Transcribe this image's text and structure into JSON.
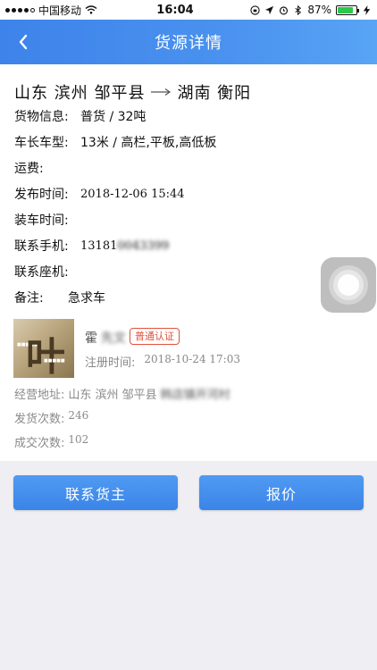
{
  "status_bar": {
    "carrier": "中国移动",
    "time": "16:04",
    "battery": "87%",
    "battery_fill": 0.87
  },
  "nav": {
    "title": "货源详情"
  },
  "route": {
    "from": "山东 滨州 邹平县",
    "to": "湖南 衡阳"
  },
  "details": {
    "cargo": {
      "label": "货物信息:",
      "value": "普货 / 32吨"
    },
    "truck": {
      "label": "车长车型:",
      "value": "13米 / 高栏,平板,高低板"
    },
    "fee": {
      "label": "运费:",
      "value": ""
    },
    "publish": {
      "label": "发布时间:",
      "value": "2018-12-06 15:44"
    },
    "load": {
      "label": "装车时间:",
      "value": ""
    },
    "mobile": {
      "label": "联系手机:",
      "value": "13181",
      "value_hidden": "0043399"
    },
    "landline": {
      "label": "联系座机:",
      "value": ""
    },
    "remark": {
      "label": "备注:",
      "value": "急求车"
    }
  },
  "owner": {
    "name": "霍",
    "name_hidden": "先文",
    "badge": "普通认证",
    "reg_label": "注册时间:",
    "reg_value": "2018-10-24 17:03",
    "avatar_glyph": "叶",
    "address_label": "经营地址:",
    "address_value": "山东 滨州 邹平县",
    "address_hidden": "韩店镇开河村",
    "ship_count_label": "发货次数:",
    "ship_count_value": "246",
    "deal_count_label": "成交次数:",
    "deal_count_value": "102"
  },
  "buttons": {
    "contact": "联系货主",
    "quote": "报价"
  },
  "colors": {
    "primary": "#3d83ea",
    "badge": "#e0503c"
  }
}
